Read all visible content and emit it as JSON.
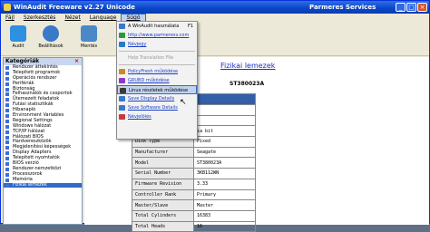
{
  "window": {
    "title": "WinAudit Freeware v2.27 Unicode",
    "brand": "Parmeres Services",
    "minimize": "_",
    "maximize": "□",
    "close": "×"
  },
  "menu": [
    "Fájl",
    "Szerkesztés",
    "Nézet",
    "Language",
    "Súgó"
  ],
  "toolbar": [
    {
      "label": "Audit",
      "color": "#2f8fe0"
    },
    {
      "label": "Beállítások",
      "color": "#3a78c8"
    },
    {
      "label": "Mentés",
      "color": "#4a88c8"
    }
  ],
  "sidebar": {
    "title": "Kategóriák",
    "close": "×",
    "items": [
      "Rendszer áttekintés",
      "Telepített programok",
      "Operációs rendszer",
      "Perifériák",
      "Biztonság",
      "Felhasználók és csoportok",
      "Ütemezett feladatok",
      "Futási statisztikák",
      "Hibanapló",
      "Environment Variables",
      "Regional Settings",
      "Windows hálózat",
      "TCP/IP hálózat",
      "Hálózati BIOS",
      "Hardvereszközök",
      "Megjelenítési képességek",
      "Display Adapters",
      "Telepített nyomtatók",
      "BIOS verzió",
      "Rendszer-nemzetközi",
      "Processzorok",
      "Memória",
      "Fizikai lemezek"
    ],
    "selected_index": 22
  },
  "dropdown": {
    "items": [
      {
        "label": "A WinAudit használata",
        "shortcut": "F1",
        "type": "normal",
        "icon": "help-icon",
        "color": "#3a78c8"
      },
      {
        "label": "http://www.parmeresv.com",
        "shortcut": "",
        "type": "link",
        "icon": "globe-icon",
        "color": "#2a9a3a"
      },
      {
        "label": "Névjegy",
        "shortcut": "",
        "type": "link",
        "icon": "info-icon",
        "color": "#2a7ac8"
      },
      {
        "sep": true
      },
      {
        "label": "Help Translation File",
        "shortcut": "",
        "type": "disabled",
        "icon": "",
        "color": ""
      },
      {
        "sep": true
      },
      {
        "label": "PolicyFresh működése",
        "shortcut": "",
        "type": "link",
        "icon": "policy-icon",
        "color": "#c88a2a"
      },
      {
        "label": "GRUBD működése",
        "shortcut": "",
        "type": "link",
        "icon": "grub-icon",
        "color": "#8a3ac8"
      },
      {
        "label": "Linux részletek működése",
        "shortcut": "",
        "type": "highlighted",
        "icon": "linux-icon",
        "color": "#3a3a3a"
      },
      {
        "label": "Save Display Details",
        "shortcut": "",
        "type": "link",
        "icon": "save-icon",
        "color": "#3a78c8"
      },
      {
        "label": "Save Software Details",
        "shortcut": "",
        "type": "link",
        "icon": "save-icon",
        "color": "#3a78c8"
      },
      {
        "label": "Névjelölés",
        "shortcut": "",
        "type": "link",
        "icon": "tag-icon",
        "color": "#c83a3a"
      }
    ]
  },
  "content": {
    "title": "Fizikai lemezek",
    "model": "ST380023A",
    "table": [
      {
        "label": "",
        "value": ""
      },
      {
        "label": "",
        "value": ""
      },
      {
        "label": "",
        "value": ""
      },
      {
        "label": "",
        "value": "ia bit"
      },
      {
        "label": "Disk Type",
        "value": "Fixed"
      },
      {
        "label": "Manufacturer",
        "value": "Seagate"
      },
      {
        "label": "Model",
        "value": "ST380023A"
      },
      {
        "label": "Serial Number",
        "value": "3KB112WN"
      },
      {
        "label": "Firmware Revision",
        "value": "3.33"
      },
      {
        "label": "Controller Rank",
        "value": "Primary"
      },
      {
        "label": "Master/Slave",
        "value": "Master"
      },
      {
        "label": "Total Cylinders",
        "value": "16383"
      },
      {
        "label": "Total Heads",
        "value": "16"
      }
    ]
  }
}
